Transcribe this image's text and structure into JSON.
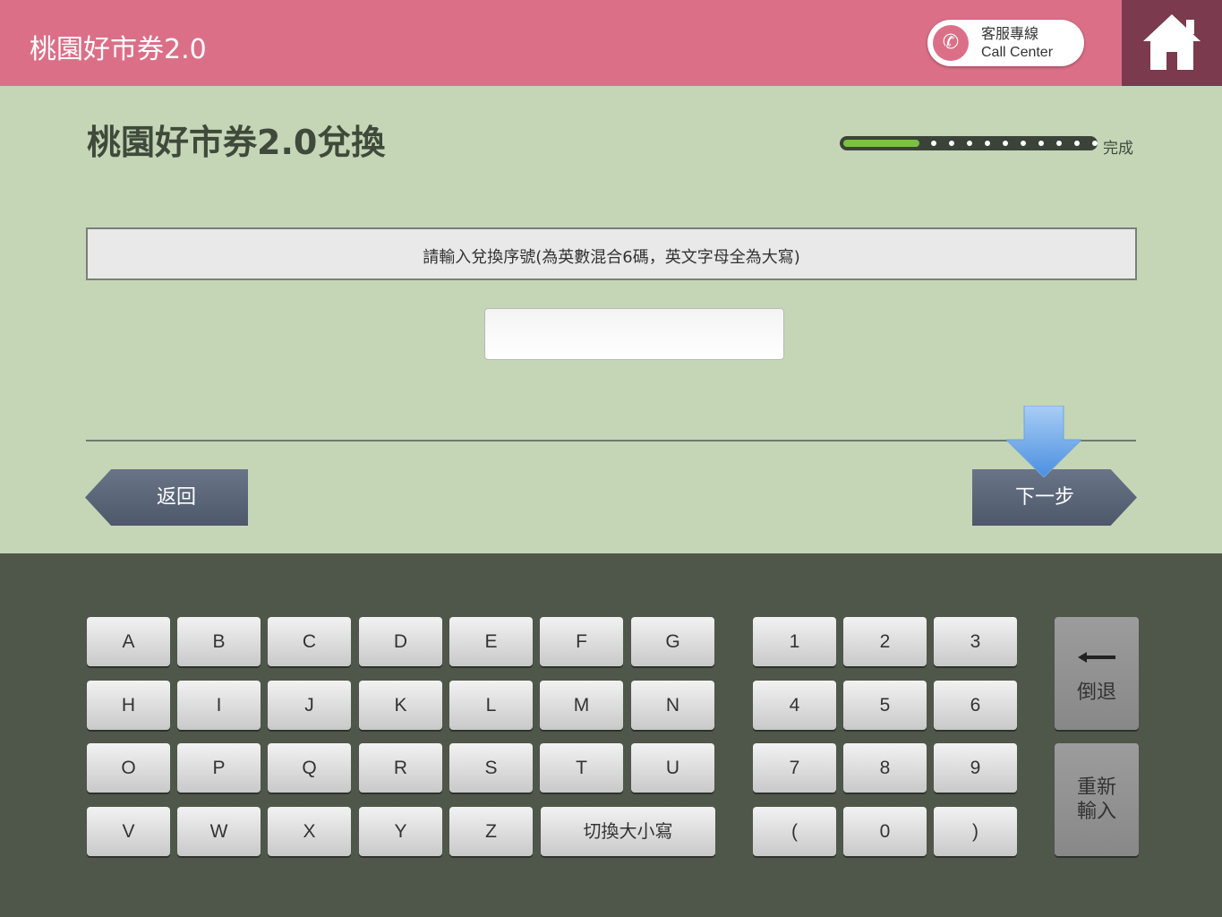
{
  "header": {
    "app_title": "桃園好市券2.0",
    "call_center_line1": "客服專線",
    "call_center_line2": "Call Center",
    "phone_icon": "phone-icon",
    "home_icon": "home-icon"
  },
  "main": {
    "page_title": "桃園好市券2.0兌換",
    "progress": {
      "fraction": 0.1,
      "steps_total": 10,
      "steps_done": 1,
      "label": "完成"
    },
    "instruction": "請輸入兌換序號(為英數混合6碼，英文字母全為大寫)",
    "code_input": {
      "value": "",
      "placeholder": ""
    },
    "back_label": "返回",
    "next_label": "下一步"
  },
  "keyboard": {
    "letter_keys": [
      "A",
      "B",
      "C",
      "D",
      "E",
      "F",
      "G",
      "H",
      "I",
      "J",
      "K",
      "L",
      "M",
      "N",
      "O",
      "P",
      "Q",
      "R",
      "S",
      "T",
      "U",
      "V",
      "W",
      "X",
      "Y",
      "Z"
    ],
    "switch_case_label": "切換大小寫",
    "number_keys": [
      "1",
      "2",
      "3",
      "4",
      "5",
      "6",
      "7",
      "8",
      "9",
      "(",
      "0",
      ")"
    ],
    "backspace_label": "倒退",
    "reset_label_line1": "重新",
    "reset_label_line2": "輸入"
  },
  "colors": {
    "header_pink": "#dc6f88",
    "home_dark": "#7b3a4d",
    "main_bg": "#c5d6b7",
    "keyboard_bg": "#4f564a",
    "nav_button": "#5d6779",
    "progress_green": "#7ac142"
  }
}
